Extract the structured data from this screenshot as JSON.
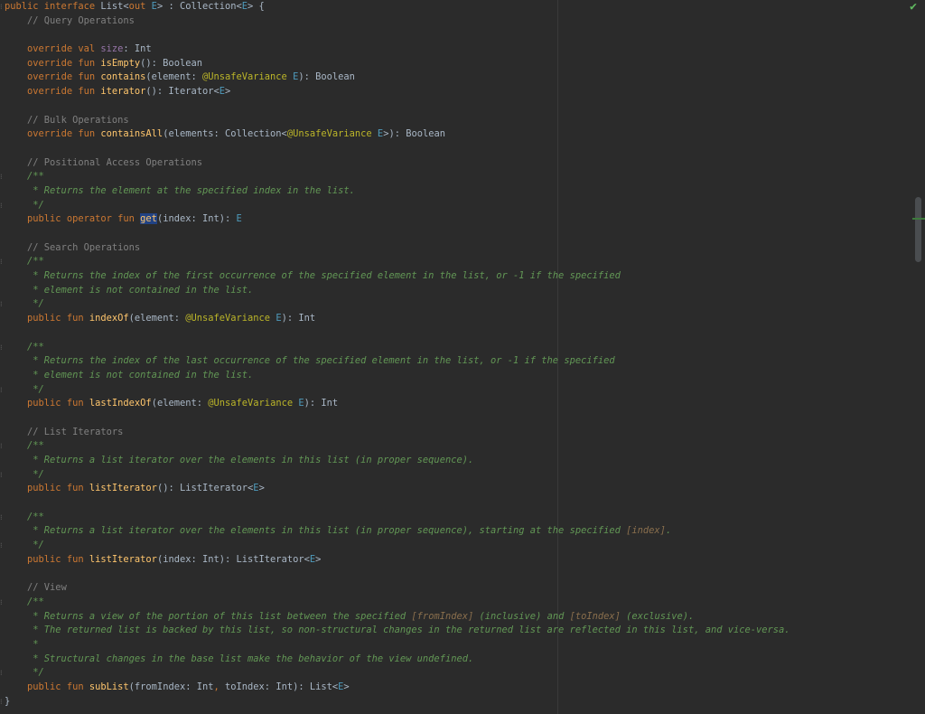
{
  "editor": {
    "status_icon": "check-icon",
    "colors": {
      "background": "#2b2b2b",
      "keyword": "#cc7832",
      "function": "#ffc66d",
      "type_param": "#4e9cbd",
      "annotation": "#bbb529",
      "comment": "#808080",
      "doc_comment": "#629755",
      "selection": "#214283",
      "status_ok": "#5fb85f"
    },
    "lines": [
      {
        "fold": true,
        "tokens": [
          [
            "kw",
            "public interface "
          ],
          [
            "txt",
            "List<"
          ],
          [
            "kw",
            "out "
          ],
          [
            "tp",
            "E"
          ],
          [
            "txt",
            "> : Collection<"
          ],
          [
            "tp",
            "E"
          ],
          [
            "txt",
            "> {"
          ]
        ]
      },
      {
        "tokens": [
          [
            "txt",
            "    "
          ],
          [
            "cm",
            "// Query Operations"
          ]
        ]
      },
      {
        "tokens": []
      },
      {
        "tokens": [
          [
            "txt",
            "    "
          ],
          [
            "kw",
            "override val "
          ],
          [
            "prop",
            "size"
          ],
          [
            "txt",
            ": Int"
          ]
        ]
      },
      {
        "tokens": [
          [
            "txt",
            "    "
          ],
          [
            "kw",
            "override fun "
          ],
          [
            "fn",
            "isEmpty"
          ],
          [
            "txt",
            "(): Boolean"
          ]
        ]
      },
      {
        "tokens": [
          [
            "txt",
            "    "
          ],
          [
            "kw",
            "override fun "
          ],
          [
            "fn",
            "contains"
          ],
          [
            "txt",
            "(element: "
          ],
          [
            "ann",
            "@UnsafeVariance "
          ],
          [
            "tp",
            "E"
          ],
          [
            "txt",
            "): Boolean"
          ]
        ]
      },
      {
        "tokens": [
          [
            "txt",
            "    "
          ],
          [
            "kw",
            "override fun "
          ],
          [
            "fn",
            "iterator"
          ],
          [
            "txt",
            "(): Iterator<"
          ],
          [
            "tp",
            "E"
          ],
          [
            "txt",
            ">"
          ]
        ]
      },
      {
        "tokens": []
      },
      {
        "tokens": [
          [
            "txt",
            "    "
          ],
          [
            "cm",
            "// Bulk Operations"
          ]
        ]
      },
      {
        "tokens": [
          [
            "txt",
            "    "
          ],
          [
            "kw",
            "override fun "
          ],
          [
            "fn",
            "containsAll"
          ],
          [
            "txt",
            "(elements: Collection<"
          ],
          [
            "ann",
            "@UnsafeVariance "
          ],
          [
            "tp",
            "E"
          ],
          [
            "txt",
            ">): Boolean"
          ]
        ]
      },
      {
        "tokens": []
      },
      {
        "tokens": [
          [
            "txt",
            "    "
          ],
          [
            "cm",
            "// Positional Access Operations"
          ]
        ]
      },
      {
        "fold": true,
        "tokens": [
          [
            "txt",
            "    "
          ],
          [
            "doc",
            "/**"
          ]
        ]
      },
      {
        "tokens": [
          [
            "txt",
            "     "
          ],
          [
            "doc",
            "* Returns the element at the specified index in the list."
          ]
        ]
      },
      {
        "fold": true,
        "tokens": [
          [
            "txt",
            "     "
          ],
          [
            "doc",
            "*/"
          ]
        ]
      },
      {
        "tokens": [
          [
            "txt",
            "    "
          ],
          [
            "kw",
            "public operator fun "
          ],
          [
            "fnhl",
            "get"
          ],
          [
            "txt",
            "(index: Int): "
          ],
          [
            "tp",
            "E"
          ]
        ]
      },
      {
        "tokens": []
      },
      {
        "tokens": [
          [
            "txt",
            "    "
          ],
          [
            "cm",
            "// Search Operations"
          ]
        ]
      },
      {
        "fold": true,
        "tokens": [
          [
            "txt",
            "    "
          ],
          [
            "doc",
            "/**"
          ]
        ]
      },
      {
        "tokens": [
          [
            "txt",
            "     "
          ],
          [
            "doc",
            "* Returns the index of the first occurrence of the specified element in the list, or -1 if the specified"
          ]
        ]
      },
      {
        "tokens": [
          [
            "txt",
            "     "
          ],
          [
            "doc",
            "* element is not contained in the list."
          ]
        ]
      },
      {
        "fold": true,
        "tokens": [
          [
            "txt",
            "     "
          ],
          [
            "doc",
            "*/"
          ]
        ]
      },
      {
        "tokens": [
          [
            "txt",
            "    "
          ],
          [
            "kw",
            "public fun "
          ],
          [
            "fn",
            "indexOf"
          ],
          [
            "txt",
            "(element: "
          ],
          [
            "ann",
            "@UnsafeVariance "
          ],
          [
            "tp",
            "E"
          ],
          [
            "txt",
            "): Int"
          ]
        ]
      },
      {
        "tokens": []
      },
      {
        "fold": true,
        "tokens": [
          [
            "txt",
            "    "
          ],
          [
            "doc",
            "/**"
          ]
        ]
      },
      {
        "tokens": [
          [
            "txt",
            "     "
          ],
          [
            "doc",
            "* Returns the index of the last occurrence of the specified element in the list, or -1 if the specified"
          ]
        ]
      },
      {
        "tokens": [
          [
            "txt",
            "     "
          ],
          [
            "doc",
            "* element is not contained in the list."
          ]
        ]
      },
      {
        "fold": true,
        "tokens": [
          [
            "txt",
            "     "
          ],
          [
            "doc",
            "*/"
          ]
        ]
      },
      {
        "tokens": [
          [
            "txt",
            "    "
          ],
          [
            "kw",
            "public fun "
          ],
          [
            "fn",
            "lastIndexOf"
          ],
          [
            "txt",
            "(element: "
          ],
          [
            "ann",
            "@UnsafeVariance "
          ],
          [
            "tp",
            "E"
          ],
          [
            "txt",
            "): Int"
          ]
        ]
      },
      {
        "tokens": []
      },
      {
        "tokens": [
          [
            "txt",
            "    "
          ],
          [
            "cm",
            "// List Iterators"
          ]
        ]
      },
      {
        "fold": true,
        "tokens": [
          [
            "txt",
            "    "
          ],
          [
            "doc",
            "/**"
          ]
        ]
      },
      {
        "tokens": [
          [
            "txt",
            "     "
          ],
          [
            "doc",
            "* Returns a list iterator over the elements in this list (in proper sequence)."
          ]
        ]
      },
      {
        "fold": true,
        "tokens": [
          [
            "txt",
            "     "
          ],
          [
            "doc",
            "*/"
          ]
        ]
      },
      {
        "tokens": [
          [
            "txt",
            "    "
          ],
          [
            "kw",
            "public fun "
          ],
          [
            "fn",
            "listIterator"
          ],
          [
            "txt",
            "(): ListIterator<"
          ],
          [
            "tp",
            "E"
          ],
          [
            "txt",
            ">"
          ]
        ]
      },
      {
        "tokens": []
      },
      {
        "fold": true,
        "tokens": [
          [
            "txt",
            "    "
          ],
          [
            "doc",
            "/**"
          ]
        ]
      },
      {
        "tokens": [
          [
            "txt",
            "     "
          ],
          [
            "doc",
            "* Returns a list iterator over the elements in this list (in proper sequence), starting at the specified "
          ],
          [
            "doctag",
            "[index]"
          ],
          [
            "doc",
            "."
          ]
        ]
      },
      {
        "fold": true,
        "tokens": [
          [
            "txt",
            "     "
          ],
          [
            "doc",
            "*/"
          ]
        ]
      },
      {
        "tokens": [
          [
            "txt",
            "    "
          ],
          [
            "kw",
            "public fun "
          ],
          [
            "fn",
            "listIterator"
          ],
          [
            "txt",
            "(index: Int): ListIterator<"
          ],
          [
            "tp",
            "E"
          ],
          [
            "txt",
            ">"
          ]
        ]
      },
      {
        "tokens": []
      },
      {
        "tokens": [
          [
            "txt",
            "    "
          ],
          [
            "cm",
            "// View"
          ]
        ]
      },
      {
        "fold": true,
        "tokens": [
          [
            "txt",
            "    "
          ],
          [
            "doc",
            "/**"
          ]
        ]
      },
      {
        "tokens": [
          [
            "txt",
            "     "
          ],
          [
            "doc",
            "* Returns a view of the portion of this list between the specified "
          ],
          [
            "doctag",
            "[fromIndex]"
          ],
          [
            "doc",
            " (inclusive) and "
          ],
          [
            "doctag",
            "[toIndex]"
          ],
          [
            "doc",
            " (exclusive)."
          ]
        ]
      },
      {
        "tokens": [
          [
            "txt",
            "     "
          ],
          [
            "doc",
            "* The returned list is backed by this list, so non-structural changes in the returned list are reflected in this list, and vice-versa."
          ]
        ]
      },
      {
        "tokens": [
          [
            "txt",
            "     "
          ],
          [
            "doc",
            "*"
          ]
        ]
      },
      {
        "tokens": [
          [
            "txt",
            "     "
          ],
          [
            "doc",
            "* Structural changes in the base list make the behavior of the view undefined."
          ]
        ]
      },
      {
        "fold": true,
        "tokens": [
          [
            "txt",
            "     "
          ],
          [
            "doc",
            "*/"
          ]
        ]
      },
      {
        "tokens": [
          [
            "txt",
            "    "
          ],
          [
            "kw",
            "public fun "
          ],
          [
            "fn",
            "subList"
          ],
          [
            "txt",
            "(fromIndex: Int"
          ],
          [
            "kw",
            ", "
          ],
          [
            "txt",
            "toIndex: Int): List<"
          ],
          [
            "tp",
            "E"
          ],
          [
            "txt",
            ">"
          ]
        ]
      },
      {
        "fold": true,
        "tokens": [
          [
            "txt",
            "}"
          ]
        ]
      }
    ]
  }
}
